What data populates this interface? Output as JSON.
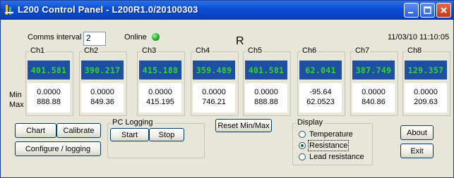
{
  "window": {
    "title": "L200 Control Panel - L200R1.0/20100303",
    "colors": {
      "titlebar": "#0a4fd6",
      "reading_bg": "#1d4fa3",
      "reading_text": "#35d235",
      "online_led": "#1fa61f"
    }
  },
  "header": {
    "comms_label": "Comms interval",
    "comms_value": "2",
    "online_label": "Online",
    "status_letter": "R",
    "datetime": "11/03/10 11:10:05"
  },
  "row_labels": {
    "min": "Min",
    "max": "Max"
  },
  "channels": [
    {
      "name": "Ch1",
      "reading": "401.581",
      "min": "0.0000",
      "max": "888.88"
    },
    {
      "name": "Ch2",
      "reading": "390.217",
      "min": "0.0000",
      "max": "849.36"
    },
    {
      "name": "Ch3",
      "reading": "415.188",
      "min": "0.0000",
      "max": "415.195"
    },
    {
      "name": "Ch4",
      "reading": "359.489",
      "min": "0.0000",
      "max": "746.21"
    },
    {
      "name": "Ch5",
      "reading": "401.581",
      "min": "0.0000",
      "max": "888.88"
    },
    {
      "name": "Ch6",
      "reading": "62.041",
      "min": "-95.64",
      "max": "62.0523"
    },
    {
      "name": "Ch7",
      "reading": "387.749",
      "min": "0.0000",
      "max": "840.86"
    },
    {
      "name": "Ch8",
      "reading": "129.357",
      "min": "0.0000",
      "max": "209.63"
    }
  ],
  "buttons": {
    "chart": "Chart",
    "calibrate": "Calibrate",
    "configure": "Configure / logging",
    "reset": "Reset Min/Max",
    "about": "About",
    "exit": "Exit"
  },
  "pc_logging": {
    "title": "PC Logging",
    "start": "Start",
    "stop": "Stop"
  },
  "display": {
    "title": "Display",
    "options": [
      "Temperature",
      "Resistance",
      "Lead resistance"
    ],
    "selected": "Resistance"
  }
}
